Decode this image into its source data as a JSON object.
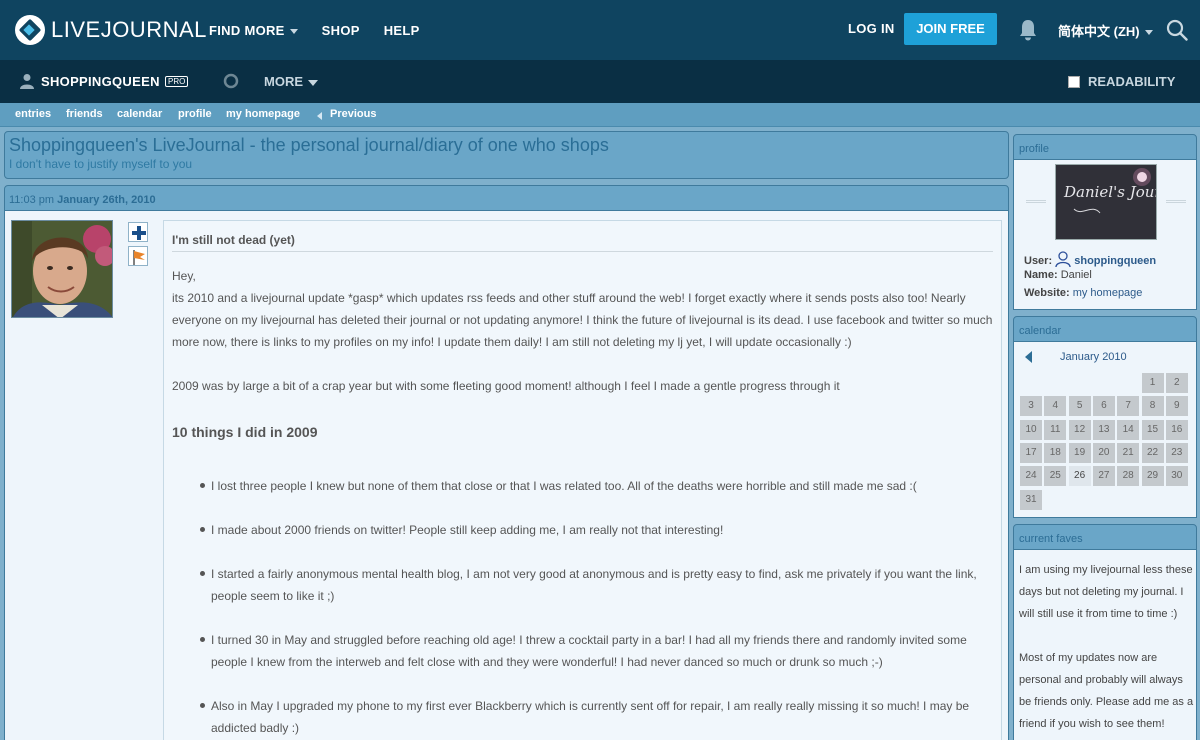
{
  "header": {
    "logo_text": "LIVEJOURNAL",
    "nav": [
      "FIND MORE",
      "SHOP",
      "HELP"
    ],
    "login": "LOG IN",
    "join": "JOIN FREE",
    "language": "简体中文 (ZH)"
  },
  "userbar": {
    "username": "SHOPPINGQUEEN",
    "badge": "PRO",
    "more": "MORE",
    "readability": "READABILITY"
  },
  "journal_nav": {
    "items": [
      "entries",
      "friends",
      "calendar",
      "profile",
      "my homepage"
    ],
    "previous": "Previous"
  },
  "journal": {
    "title": "Shoppingqueen's LiveJournal - the personal journal/diary of one who shops",
    "subtitle": "I don't have to justify myself to you"
  },
  "entry": {
    "time": "11:03 pm",
    "date": "January 26th, 2010",
    "subject": "I'm still not dead (yet)",
    "paragraphs": [
      "Hey,",
      "its 2010 and a livejournal update *gasp* which updates rss feeds and other stuff around the web! I forget exactly where it sends posts also too! Nearly everyone on my livejournal has deleted their journal or not updating anymore! I think the future of livejournal is its dead. I use facebook and twitter so much more now, there is links to my profiles on my info! I update them daily! I am still not deleting my lj yet, I will update occasionally :)",
      "2009 was by large a bit of a crap year but with some fleeting good moment! although I feel I made a gentle progress through it"
    ],
    "heading": "10 things I did in 2009",
    "bullets": [
      "I lost three people I knew but none of them that close or that I was related too. All of the deaths were horrible and still made me sad :(",
      "I made about 2000 friends on twitter! People still keep adding me, I am really not that interesting!",
      "I started a fairly anonymous mental health blog, I am not very good at anonymous and is pretty easy to find, ask me privately if you want the link, people seem to like it ;)",
      "I turned 30 in May and struggled before reaching old age! I threw a cocktail party in a bar! I had all my friends there and randomly invited some people I knew from the interweb and felt close with and they were wonderful! I had never danced so much or drunk so much ;-)",
      "Also in May I upgraded my phone to my first ever Blackberry which is currently sent off for repair, I am really really missing it so much! I may be addicted badly :)"
    ]
  },
  "sidebar": {
    "profile": {
      "heading": "profile",
      "pic_text": "Daniel's Journal",
      "user_label": "User:",
      "user": "shoppingqueen",
      "name_label": "Name:",
      "name": "Daniel",
      "website_label": "Website:",
      "website": "my homepage"
    },
    "calendar": {
      "heading": "calendar",
      "month": "January 2010",
      "days": [
        "1",
        "2",
        "3",
        "4",
        "5",
        "6",
        "7",
        "8",
        "9",
        "10",
        "11",
        "12",
        "13",
        "14",
        "15",
        "16",
        "17",
        "18",
        "19",
        "20",
        "21",
        "22",
        "23",
        "24",
        "25",
        "26",
        "27",
        "28",
        "29",
        "30",
        "31"
      ]
    },
    "faves": {
      "heading": "current faves",
      "text": "I am using my livejournal less these days but not deleting my journal. I will still use it from time to time :)",
      "text2": "Most of my updates now are personal and probably will always be friends only. Please add me as a friend if you wish to see them!"
    }
  }
}
